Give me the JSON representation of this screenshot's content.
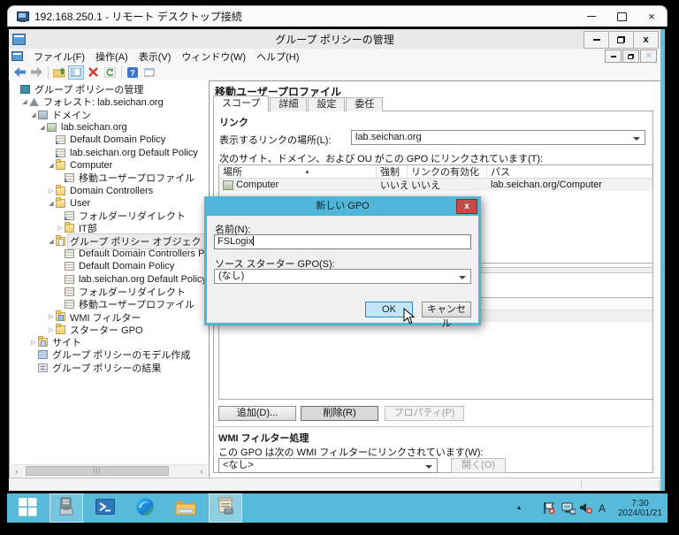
{
  "rdp": {
    "title": "192.168.250.1 - リモート デスクトップ接続",
    "caption_icons": [
      "minimize-icon",
      "maximize-icon",
      "close-icon"
    ]
  },
  "mmc": {
    "title": "グループ ポリシーの管理",
    "caption_icons": [
      "minimize-icon",
      "restore-icon",
      "close-icon"
    ],
    "menus": [
      "ファイル(F)",
      "操作(A)",
      "表示(V)",
      "ウィンドウ(W)",
      "ヘルプ(H)"
    ],
    "toolbar_icons": [
      "back-icon",
      "forward-icon",
      "up-icon",
      "console-tree-icon",
      "delete-icon",
      "refresh-icon",
      "help-icon",
      "new-window-icon"
    ]
  },
  "tree": {
    "items": [
      {
        "label": "グループ ポリシーの管理",
        "level": 0,
        "icon": "console",
        "expand": "none"
      },
      {
        "label": "フォレスト: lab.seichan.org",
        "level": 1,
        "icon": "forest",
        "expand": "open"
      },
      {
        "label": "ドメイン",
        "level": 2,
        "icon": "domains",
        "expand": "open"
      },
      {
        "label": "lab.seichan.org",
        "level": 3,
        "icon": "domain",
        "expand": "open"
      },
      {
        "label": "Default Domain Policy",
        "level": 4,
        "icon": "gpolink",
        "expand": "none"
      },
      {
        "label": "lab.seichan.org Default Policy",
        "level": 4,
        "icon": "gpolink",
        "expand": "none"
      },
      {
        "label": "Computer",
        "level": 4,
        "icon": "ou",
        "expand": "open"
      },
      {
        "label": "移動ユーザープロファイル",
        "level": 5,
        "icon": "gpolink",
        "expand": "none"
      },
      {
        "label": "Domain Controllers",
        "level": 4,
        "icon": "ou",
        "expand": "closed"
      },
      {
        "label": "User",
        "level": 4,
        "icon": "ou",
        "expand": "open"
      },
      {
        "label": "フォルダーリダイレクト",
        "level": 5,
        "icon": "gpolink",
        "expand": "none"
      },
      {
        "label": "IT部",
        "level": 5,
        "icon": "ou",
        "expand": "closed"
      },
      {
        "label": "グループ ポリシー オブジェクト",
        "level": 4,
        "icon": "gpofolder",
        "expand": "open",
        "selected": true
      },
      {
        "label": "Default Domain Controllers Policy",
        "level": 5,
        "icon": "gpo",
        "expand": "none"
      },
      {
        "label": "Default Domain Policy",
        "level": 5,
        "icon": "gpo",
        "expand": "none"
      },
      {
        "label": "lab.seichan.org Default Policy",
        "level": 5,
        "icon": "gpo",
        "expand": "none"
      },
      {
        "label": "フォルダーリダイレクト",
        "level": 5,
        "icon": "gpo",
        "expand": "none"
      },
      {
        "label": "移動ユーザープロファイル",
        "level": 5,
        "icon": "gpo",
        "expand": "none"
      },
      {
        "label": "WMI フィルター",
        "level": 4,
        "icon": "wmi",
        "expand": "closed"
      },
      {
        "label": "スターター GPO",
        "level": 4,
        "icon": "folder",
        "expand": "closed"
      },
      {
        "label": "サイト",
        "level": 2,
        "icon": "sites",
        "expand": "closed"
      },
      {
        "label": "グループ ポリシーのモデル作成",
        "level": 2,
        "icon": "modeling",
        "expand": "none"
      },
      {
        "label": "グループ ポリシーの結果",
        "level": 2,
        "icon": "results",
        "expand": "none"
      }
    ]
  },
  "content": {
    "title": "移動ユーザープロファイル",
    "tabs": [
      {
        "label": "スコープ",
        "active": true
      },
      {
        "label": "詳細",
        "active": false
      },
      {
        "label": "設定",
        "active": false
      },
      {
        "label": "委任",
        "active": false
      }
    ],
    "links_section": {
      "heading": "リンク",
      "display_label": "表示するリンクの場所(L):",
      "display_value": "lab.seichan.org",
      "table_label": "次のサイト、ドメイン、および OU がこの GPO にリンクされています(T):",
      "columns": [
        "場所",
        "強制",
        "リンクの有効化",
        "パス"
      ],
      "rows": [
        {
          "location": "Computer",
          "enforced": "いいえ",
          "link_enabled": "いいえ",
          "path": "lab.seichan.org/Computer"
        }
      ]
    },
    "security_section": {
      "add_button": "追加(D)...",
      "remove_button": "削除(R)",
      "properties_button": "プロパティ(P)"
    },
    "wmi_section": {
      "heading": "WMI フィルター処理",
      "label": "この GPO は次の WMI フィルターにリンクされています(W):",
      "value": "<なし>",
      "open_button": "開く(O)"
    }
  },
  "dialog": {
    "title": "新しい GPO",
    "close_label": "x",
    "name_label": "名前(N):",
    "name_value": "FSLogix",
    "source_label": "ソース スターター GPO(S):",
    "source_value": "(なし)",
    "ok_label": "OK",
    "cancel_label": "キャンセル"
  },
  "taskbar": {
    "icons": [
      "start",
      "server-manager",
      "powershell",
      "edge",
      "file-explorer",
      "gpmc"
    ],
    "tray": {
      "icons": [
        "hidden-icons-chevron",
        "action-center-flag-error",
        "network-error",
        "volume-muted",
        "ime-indicator"
      ],
      "ime": "A",
      "time": "7:30",
      "date": "2024/01/21"
    }
  },
  "colors": {
    "taskbar_blue": "#57bad8",
    "dialog_chrome": "#4fb6d9",
    "close_button_red": "#c04b47",
    "ok_button_fill": "#c3e6f6",
    "mmc_accent_border": "#5cc0df"
  }
}
